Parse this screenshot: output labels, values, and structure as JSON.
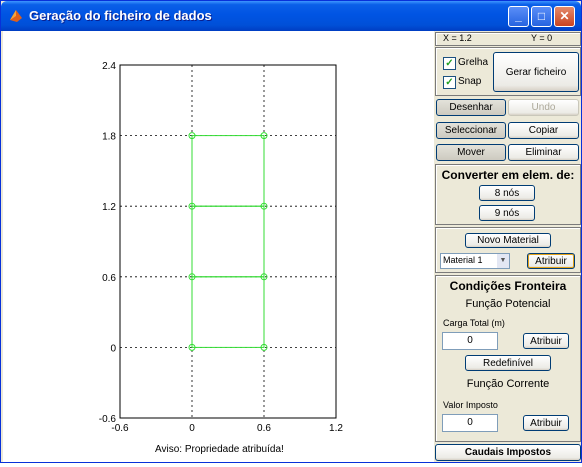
{
  "window": {
    "title": "Geração do ficheiro de dados",
    "minimize_icon": "minimize-icon",
    "maximize_icon": "maximize-icon",
    "close_icon": "close-icon"
  },
  "coords": {
    "x": "X = 1.2",
    "y": "Y = 0"
  },
  "options": {
    "grelha": "Grelha",
    "snap": "Snap",
    "grelha_checked": true,
    "snap_checked": true,
    "gerar": "Gerar ficheiro"
  },
  "tools": {
    "desenhar": "Desenhar",
    "undo": "Undo",
    "seleccionar": "Seleccionar",
    "copiar": "Copiar",
    "mover": "Mover",
    "eliminar": "Eliminar"
  },
  "convert": {
    "title": "Converter em elem. de:",
    "nos8": "8 nós",
    "nos9": "9 nós"
  },
  "material": {
    "novo": "Novo Material",
    "selected": "Material 1",
    "atribuir": "Atribuir"
  },
  "fronteira": {
    "title": "Condições Fronteira",
    "potencial": "Função Potencial",
    "carga_label": "Carga Total (m)",
    "carga_value": "0",
    "atribuir1": "Atribuir",
    "redefinivel": "Redefinível",
    "corrente": "Função Corrente",
    "valor_label": "Valor Imposto",
    "valor_value": "0",
    "atribuir2": "Atribuir"
  },
  "caudais": "Caudais Impostos",
  "status": "Aviso: Propriedade atribuída!",
  "chart_data": {
    "type": "scatter",
    "xlim": [
      -0.6,
      1.2
    ],
    "ylim": [
      -0.6,
      2.4
    ],
    "xticks": [
      "-0.6",
      "0",
      "0.6",
      "1.2"
    ],
    "yticks": [
      "-0.6",
      "0",
      "0.6",
      "1.2",
      "1.8",
      "2.4"
    ],
    "grid": true,
    "color": "#33dd33",
    "nodes": [
      [
        0,
        0
      ],
      [
        0.6,
        0
      ],
      [
        0,
        0.6
      ],
      [
        0.6,
        0.6
      ],
      [
        0,
        1.2
      ],
      [
        0.6,
        1.2
      ],
      [
        0,
        1.8
      ],
      [
        0.6,
        1.8
      ]
    ],
    "elements": [
      [
        0,
        0,
        0.6,
        0.6
      ],
      [
        0,
        0.6,
        0.6,
        1.2
      ],
      [
        0,
        1.2,
        0.6,
        1.8
      ]
    ]
  }
}
